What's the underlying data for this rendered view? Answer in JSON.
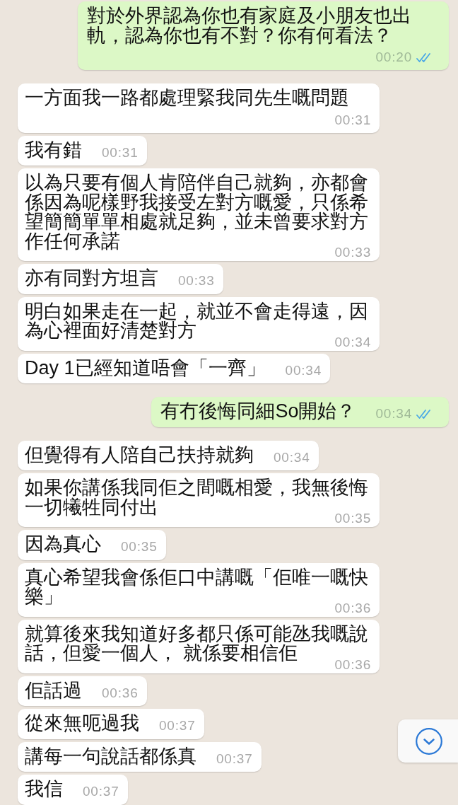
{
  "messages": [
    {
      "kind": "outgoing",
      "text": "對於外界認為你也有家庭及小朋友也出軌，認為你也有不對？你有何看法？",
      "time": "00:20",
      "read": true
    },
    {
      "kind": "incoming",
      "text": "一方面我一路都處理緊我同先生嘅問題",
      "time": "00:31"
    },
    {
      "kind": "incoming",
      "text": "我有錯",
      "time": "00:31"
    },
    {
      "kind": "incoming",
      "text": "以為只要有個人肯陪伴自己就夠，亦都會係因為呢樣野我接受左對方嘅愛，只係希望簡簡單單相處就足夠，並未曾要求對方作任何承諾",
      "time": "00:33"
    },
    {
      "kind": "incoming",
      "text": "亦有同對方坦言",
      "time": "00:33"
    },
    {
      "kind": "incoming",
      "text": "明白如果走在一起，就並不會走得遠，因為心裡面好清楚對方",
      "time": "00:34"
    },
    {
      "kind": "incoming",
      "text": "Day 1已經知道唔會「一齊」",
      "time": "00:34"
    },
    {
      "kind": "outgoing",
      "text": "有冇後悔同細So開始？",
      "time": "00:34",
      "read": true
    },
    {
      "kind": "incoming",
      "text": "但覺得有人陪自己扶持就夠",
      "time": "00:34"
    },
    {
      "kind": "incoming",
      "text": "如果你講係我同佢之間嘅相愛，我無後悔一切犧牲同付出",
      "time": "00:35"
    },
    {
      "kind": "incoming",
      "text": "因為真心",
      "time": "00:35"
    },
    {
      "kind": "incoming",
      "text": "真心希望我會係佢口中講嘅「佢唯一嘅快樂」",
      "time": "00:36"
    },
    {
      "kind": "incoming",
      "text": "就算後來我知道好多都只係可能氹我嘅說話，但愛一個人， 就係要相信佢",
      "time": "00:36"
    },
    {
      "kind": "incoming",
      "text": "佢話過",
      "time": "00:36"
    },
    {
      "kind": "incoming",
      "text": "從來無呃過我",
      "time": "00:37"
    },
    {
      "kind": "incoming",
      "text": "講每一句說話都係真",
      "time": "00:37"
    },
    {
      "kind": "incoming",
      "text": "我信",
      "time": "00:37"
    }
  ]
}
